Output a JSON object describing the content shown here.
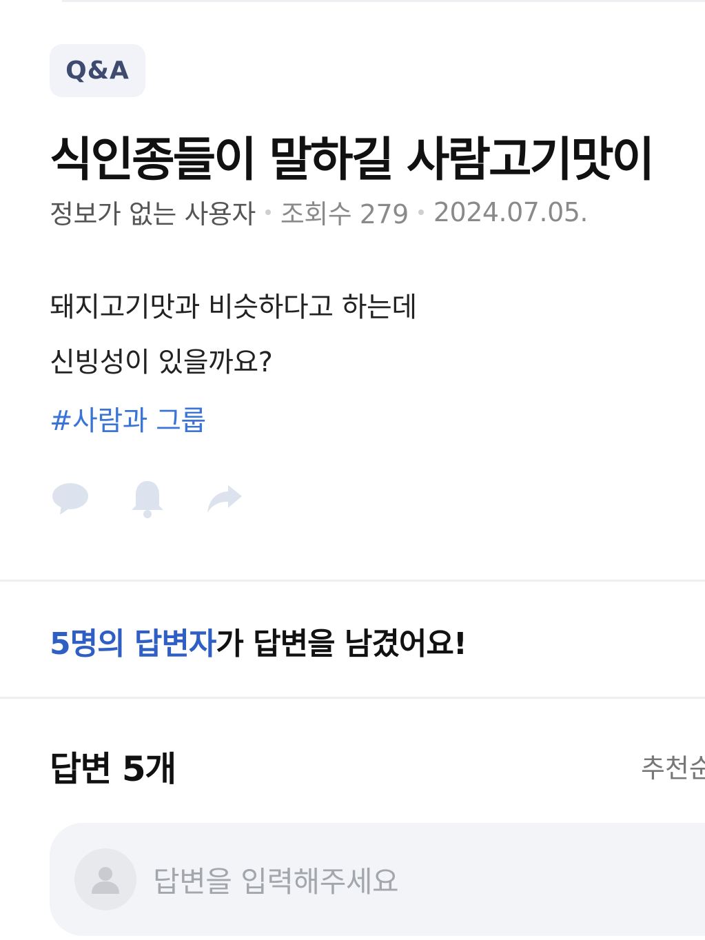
{
  "post": {
    "category": "Q&A",
    "title": "식인종들이 말하길 사람고기맛이",
    "author": "정보가 없는 사용자",
    "views": "조회수 279",
    "date": "2024.07.05.",
    "body_lines": [
      "돼지고기맛과 비슷하다고 하는데",
      "신빙성이 있을까요?"
    ],
    "tag": "#사람과 그룹"
  },
  "actions": {
    "comment_icon": "comment-icon",
    "bell_icon": "bell-icon",
    "share_icon": "share-icon"
  },
  "answerers": {
    "highlight": "5명의 답변자",
    "rest": "가 답변을 남겼어요!"
  },
  "answers": {
    "header": "답변 5개",
    "sort": "추천순"
  },
  "answer_input": {
    "placeholder": "답변을 입력해주세요",
    "avatar_icon": "user-avatar-icon"
  },
  "colors": {
    "accent_blue": "#2f5fc4",
    "tag_blue": "#3a74d6",
    "badge_bg": "#f1f3f8",
    "icon_gray": "#dde3ee"
  }
}
